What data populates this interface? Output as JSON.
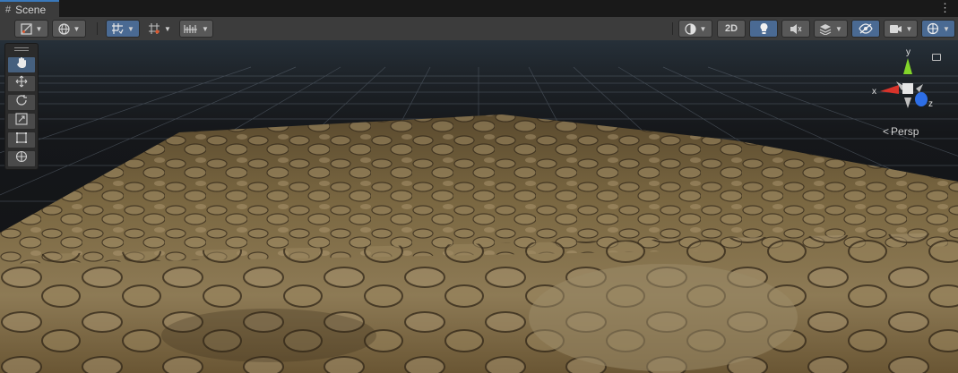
{
  "window": {
    "tab_title": "Scene"
  },
  "toolbar": {
    "left_buttons": [
      {
        "name": "draw-mode-button",
        "icon": "draw-mode-icon",
        "dropdown": true
      },
      {
        "name": "global-local-button",
        "icon": "globe-icon",
        "dropdown": true
      },
      {
        "name": "snap-toggle-button",
        "icon": "grid-snap-icon",
        "dropdown": true,
        "active": true
      },
      {
        "name": "grid-settings-button",
        "icon": "grid-icon",
        "dropdown": true
      },
      {
        "name": "increment-snap-button",
        "icon": "ruler-icon",
        "dropdown": true
      }
    ],
    "right_buttons": {
      "shading": {
        "icon": "shading-sphere-icon",
        "dropdown": true
      },
      "mode_2d": "2D",
      "lighting": {
        "icon": "light-bulb-icon",
        "active": true
      },
      "audio": {
        "icon": "audio-mute-icon"
      },
      "effects": {
        "icon": "effects-layers-icon",
        "dropdown": true
      },
      "hidden_objects": {
        "icon": "eye-slash-icon",
        "active": true
      },
      "camera": {
        "icon": "camera-icon",
        "dropdown": true
      },
      "gizmos": {
        "icon": "gizmo-globe-icon",
        "dropdown": true,
        "active": true
      }
    }
  },
  "tools": [
    {
      "name": "hand-tool",
      "icon": "hand-icon",
      "active": true
    },
    {
      "name": "move-tool",
      "icon": "move-arrows-icon"
    },
    {
      "name": "rotate-tool",
      "icon": "rotate-icon"
    },
    {
      "name": "scale-tool",
      "icon": "scale-icon"
    },
    {
      "name": "rect-tool",
      "icon": "rect-icon"
    },
    {
      "name": "transform-tool",
      "icon": "transform-icon"
    }
  ],
  "orientation_gizmo": {
    "labels": {
      "x": "x",
      "y": "y",
      "z": "z"
    },
    "axis_colors": {
      "x": "#d8332a",
      "y": "#83d52a",
      "z": "#2d6ee6"
    },
    "projection": "Persp"
  },
  "scene": {
    "ground_colors": [
      "#6a5532",
      "#8f7a52",
      "#4a3a22"
    ],
    "grid_color": "#5a6470"
  }
}
